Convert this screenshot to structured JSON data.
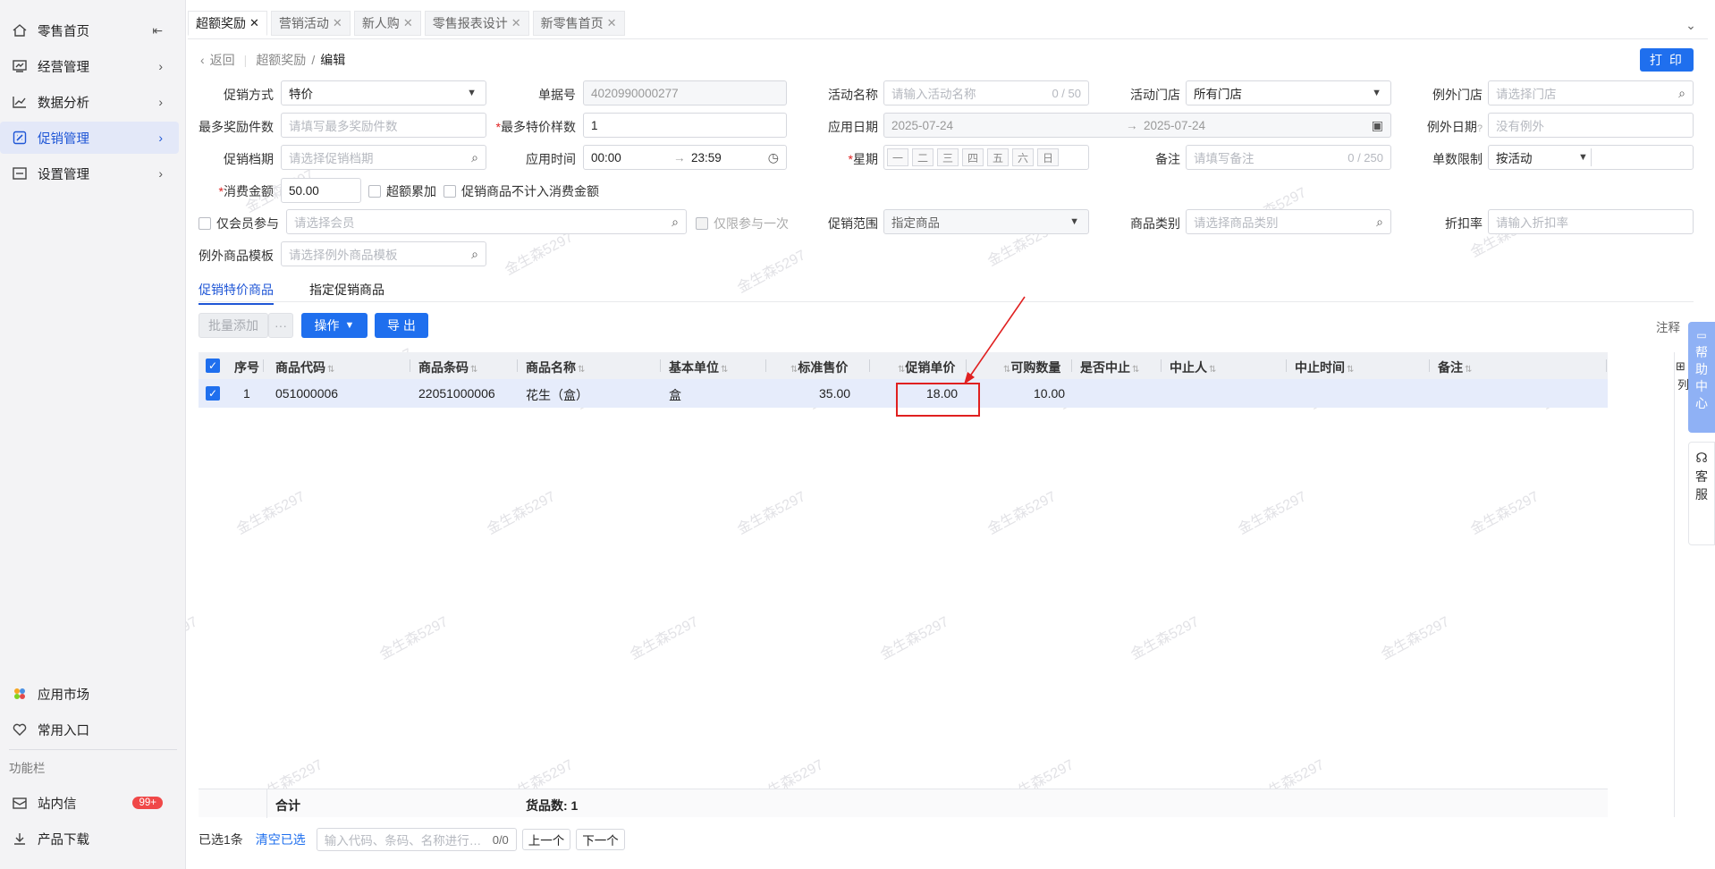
{
  "sidebar": {
    "items": [
      {
        "label": "零售首页",
        "icon": "home-icon",
        "extra": "⇤"
      },
      {
        "label": "经营管理",
        "icon": "monitor-chart-icon",
        "extra": "›"
      },
      {
        "label": "数据分析",
        "icon": "line-chart-icon",
        "extra": "›"
      },
      {
        "label": "促销管理",
        "icon": "promo-icon",
        "extra": "›",
        "active": true
      },
      {
        "label": "设置管理",
        "icon": "settings-box-icon",
        "extra": "›"
      }
    ],
    "bottom_items": [
      {
        "label": "应用市场",
        "icon": "app-market-icon"
      },
      {
        "label": "常用入口",
        "icon": "heart-icon"
      },
      {
        "label": "站内信",
        "icon": "mail-icon",
        "badge": "99+"
      },
      {
        "label": "产品下载",
        "icon": "download-icon"
      }
    ],
    "func_label": "功能栏"
  },
  "tabs": [
    {
      "label": "超额奖励",
      "active": true
    },
    {
      "label": "营销活动"
    },
    {
      "label": "新人购"
    },
    {
      "label": "零售报表设计"
    },
    {
      "label": "新零售首页"
    }
  ],
  "breadcrumb": {
    "back": "返回",
    "parent": "超额奖励",
    "sep": "/",
    "current": "编辑"
  },
  "print_label": "打 印",
  "form": {
    "promo_type": {
      "label": "促销方式",
      "value": "特价"
    },
    "doc_no": {
      "label": "单据号",
      "value": "4020990000277"
    },
    "activity_name": {
      "label": "活动名称",
      "placeholder": "请输入活动名称",
      "count": "0 / 50"
    },
    "activity_store": {
      "label": "活动门店",
      "value": "所有门店"
    },
    "exclude_store": {
      "label": "例外门店",
      "placeholder": "请选择门店"
    },
    "max_reward": {
      "label": "最多奖励件数",
      "placeholder": "请填写最多奖励件数"
    },
    "max_special": {
      "label": "最多特价样数",
      "value": "1"
    },
    "apply_date": {
      "label": "应用日期",
      "start": "2025-07-24",
      "end": "2025-07-24"
    },
    "exclude_date": {
      "label": "例外日期",
      "placeholder": "没有例外"
    },
    "promo_file": {
      "label": "促销档期",
      "placeholder": "请选择促销档期"
    },
    "apply_time": {
      "label": "应用时间",
      "start": "00:00",
      "end": "23:59"
    },
    "week": {
      "label": "星期",
      "days": [
        "一",
        "二",
        "三",
        "四",
        "五",
        "六",
        "日"
      ]
    },
    "remark": {
      "label": "备注",
      "placeholder": "请填写备注",
      "count": "0 / 250"
    },
    "limit": {
      "label": "单数限制",
      "value": "按活动"
    },
    "amount": {
      "label": "消费金额",
      "value": "50.00"
    },
    "cb_excess": "超额累加",
    "cb_exclude": "促销商品不计入消费金额",
    "member_only": "仅会员参与",
    "member_ph": "请选择会员",
    "once_only": "仅限参与一次",
    "scope": {
      "label": "促销范围",
      "value": "指定商品"
    },
    "category": {
      "label": "商品类别",
      "placeholder": "请选择商品类别"
    },
    "discount": {
      "label": "折扣率",
      "placeholder": "请输入折扣率"
    },
    "template": {
      "label": "例外商品模板",
      "placeholder": "请选择例外商品模板"
    }
  },
  "subtabs": [
    "促销特价商品",
    "指定促销商品"
  ],
  "toolbar": {
    "batch_add": "批量添加",
    "more": "···",
    "ops": "操作",
    "export": "导 出",
    "note": "注释"
  },
  "table": {
    "headers": [
      "序号",
      "商品代码",
      "商品条码",
      "商品名称",
      "基本单位",
      "标准售价",
      "促销单价",
      "可购数量",
      "是否中止",
      "中止人",
      "中止时间",
      "备注"
    ],
    "rows": [
      {
        "no": "1",
        "code": "051000006",
        "barcode": "22051000006",
        "name": "花生（盒）",
        "unit": "盒",
        "price": "35.00",
        "promo_price": "18.00",
        "qty": "10.00"
      }
    ],
    "footer_total": "合计",
    "footer_count": "货品数: 1"
  },
  "bottom": {
    "selected": "已选1条",
    "clear": "清空已选",
    "search_ph": "输入代码、条码、名称进行…",
    "count": "0/0",
    "prev": "上一个",
    "next": "下一个"
  },
  "help_chars": [
    "帮",
    "助",
    "中",
    "心"
  ],
  "kefu_chars": [
    "客",
    "服"
  ],
  "col_setting": "列",
  "watermark": "金生森5297"
}
